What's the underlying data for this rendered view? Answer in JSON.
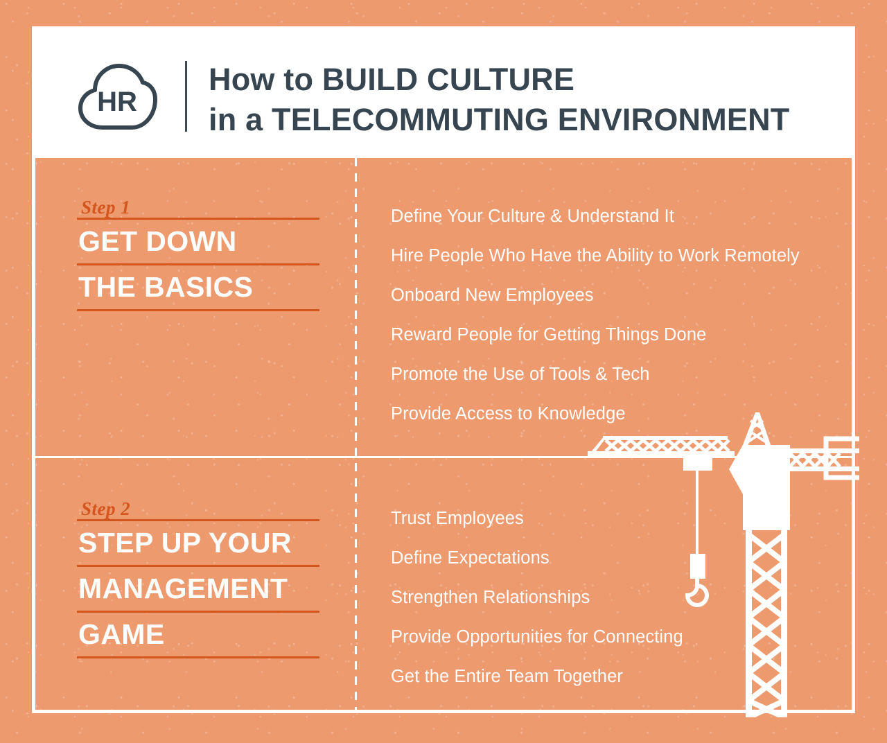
{
  "colors": {
    "background": "#ed9a6e",
    "panel": "#ffffff",
    "heading_text": "#36454f",
    "accent_rule": "#d4561f",
    "body_text": "#ffffff"
  },
  "header": {
    "logo_text": "HR",
    "logo_icon": "cloud-icon",
    "title_line_1": "How to BUILD CULTURE",
    "title_line_2": "in a TELECOMMUTING ENVIRONMENT"
  },
  "steps": [
    {
      "label": "Step 1",
      "title_lines": [
        "GET DOWN",
        "THE BASICS"
      ],
      "items": [
        "Define Your Culture & Understand It",
        "Hire People Who Have the Ability to Work Remotely",
        "Onboard New Employees",
        "Reward People for Getting Things Done",
        "Promote the Use of Tools & Tech",
        "Provide Access to Knowledge"
      ]
    },
    {
      "label": "Step 2",
      "title_lines": [
        "STEP UP YOUR",
        "MANAGEMENT",
        "GAME"
      ],
      "items": [
        "Trust Employees",
        "Define Expectations",
        "Strengthen Relationships",
        "Provide Opportunities for Connecting",
        "Get the Entire Team Together"
      ]
    }
  ],
  "illustration": {
    "name": "tower-crane-icon",
    "parts": [
      "jib",
      "mast",
      "cab",
      "counter-jib",
      "counterweight",
      "hook-block",
      "hook",
      "apex-a-frame"
    ]
  }
}
